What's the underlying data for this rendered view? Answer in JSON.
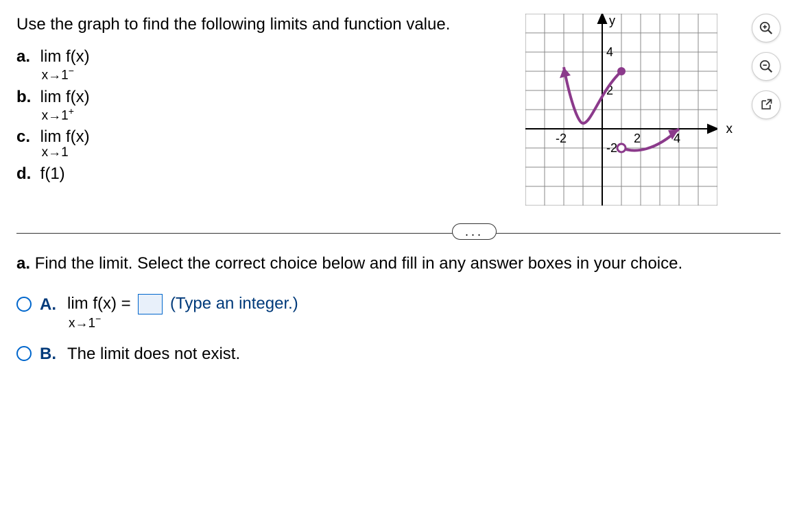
{
  "instructions": "Use the graph to find the following limits and function value.",
  "parts": {
    "a": {
      "label": "a.",
      "top": "lim f(x)",
      "bottom": "x→1",
      "sup": "−"
    },
    "b": {
      "label": "b.",
      "top": "lim f(x)",
      "bottom": "x→1",
      "sup": "+"
    },
    "c": {
      "label": "c.",
      "top": "lim f(x)",
      "bottom": "x→1",
      "sup": ""
    },
    "d": {
      "label": "d.",
      "text": "f(1)"
    }
  },
  "graph": {
    "y_label": "y",
    "x_label": "x",
    "ticks": {
      "y_pos": "4",
      "y_pos2": "2",
      "y_neg": "-2",
      "x_neg": "-2",
      "x_pos": "2",
      "x_pos2": "4"
    }
  },
  "separator": "...",
  "question": {
    "prompt_label": "a.",
    "prompt_text": "Find the limit. Select the correct choice below and fill in any answer boxes in your choice.",
    "choiceA": {
      "label": "A.",
      "lim_top": "lim f(x) =",
      "lim_bottom": "x→1",
      "lim_sup": "−",
      "hint": "(Type an integer.)"
    },
    "choiceB": {
      "label": "B.",
      "text": "The limit does not exist."
    }
  },
  "chart_data": {
    "type": "line",
    "title": "",
    "xlabel": "x",
    "ylabel": "y",
    "xlim": [
      -4,
      6
    ],
    "ylim": [
      -4,
      6
    ],
    "series": [
      {
        "name": "left-branch",
        "x": [
          -2,
          -1.5,
          -1,
          -0.5,
          0,
          0.5,
          1
        ],
        "y": [
          3.2,
          1.2,
          0.3,
          0.6,
          1.6,
          2.5,
          3
        ],
        "endpoint": "closed"
      },
      {
        "name": "right-branch",
        "x": [
          1,
          2,
          3,
          4
        ],
        "y": [
          -1,
          -1.2,
          -0.8,
          0
        ],
        "start_endpoint": "open"
      }
    ],
    "open_points": [
      {
        "x": 1,
        "y": -1
      }
    ],
    "closed_points": [
      {
        "x": 1,
        "y": 3
      }
    ]
  }
}
